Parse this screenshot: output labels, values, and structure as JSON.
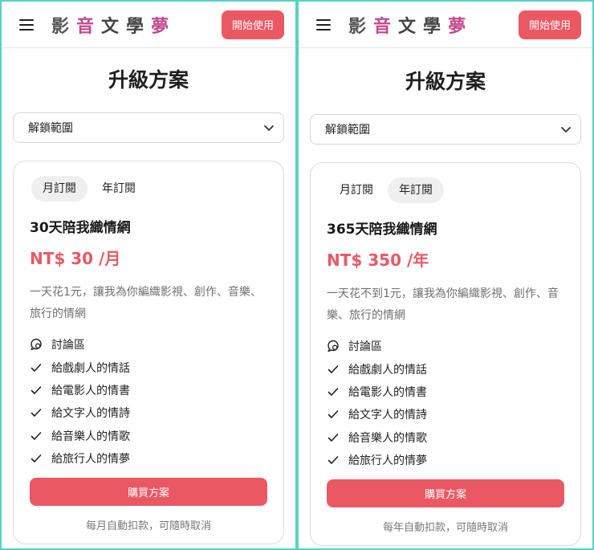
{
  "header": {
    "logo_chars": [
      "影",
      "音",
      "文",
      "學",
      "夢"
    ],
    "logo_colors": [
      "#555555",
      "#c4488c",
      "#444444",
      "#444444",
      "#c4488c"
    ],
    "start_button": "開始使用"
  },
  "page_title": "升級方案",
  "scope_select": {
    "selected": "解鎖範圍"
  },
  "tabs": {
    "monthly": "月訂閱",
    "yearly": "年訂閱"
  },
  "panels": [
    {
      "active_tab": "monthly",
      "plan_title": "30天陪我織情網",
      "price": "NT$ 30 /月",
      "description": "一天花1元，讓我為你編織影視、創作、音樂、旅行的情網",
      "features": [
        "討論區",
        "給戲劇人的情話",
        "給電影人的情書",
        "給文字人的情詩",
        "給音樂人的情歌",
        "給旅行人的情夢"
      ],
      "buy_button": "購買方案",
      "note": "每月自動扣款，可隨時取消"
    },
    {
      "active_tab": "yearly",
      "plan_title": "365天陪我織情網",
      "price": "NT$ 350 /年",
      "description": "一天花不到1元，讓我為你編織影視、創作、音樂、旅行的情網",
      "features": [
        "討論區",
        "給戲劇人的情話",
        "給電影人的情書",
        "給文字人的情詩",
        "給音樂人的情歌",
        "給旅行人的情夢"
      ],
      "buy_button": "購買方案",
      "note": "每年自動扣款，可隨時取消"
    }
  ],
  "colors": {
    "accent": "#ea5863",
    "frame": "#53d3c6"
  }
}
